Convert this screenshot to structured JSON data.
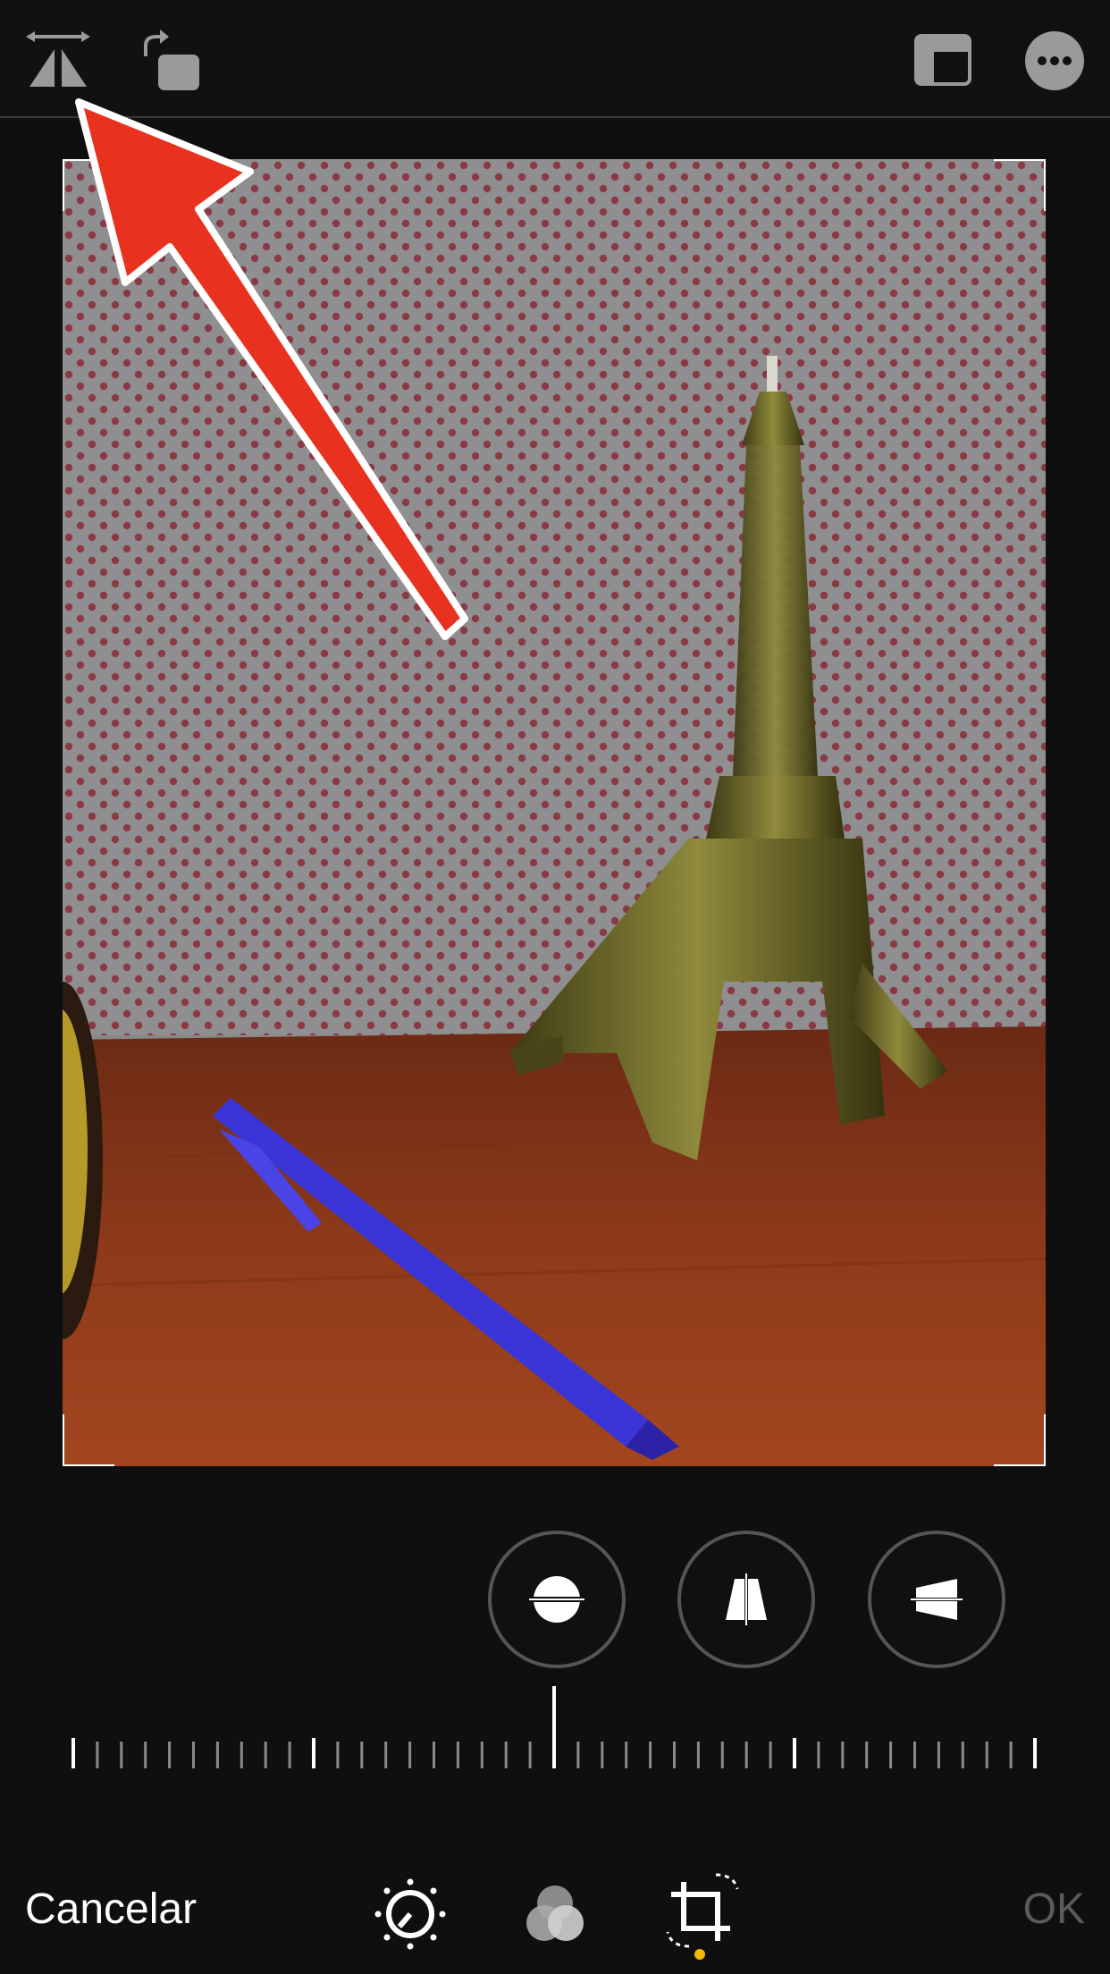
{
  "toolbar": {
    "flip_icon": "flip-horizontal-icon",
    "rotate_icon": "rotate-icon",
    "aspect_icon": "aspect-ratio-icon",
    "more_icon": "more-icon"
  },
  "adjust_tools": [
    {
      "name": "straighten",
      "icon": "straighten-icon"
    },
    {
      "name": "vertical",
      "icon": "vertical-perspective-icon"
    },
    {
      "name": "horizontal",
      "icon": "horizontal-perspective-icon"
    }
  ],
  "bottom": {
    "cancel_label": "Cancelar",
    "ok_label": "OK",
    "tabs": [
      {
        "icon": "adjust-dial-icon"
      },
      {
        "icon": "filters-icon"
      },
      {
        "icon": "crop-icon",
        "active": true
      }
    ]
  },
  "colors": {
    "background": "#0f0f0f",
    "accent_dot": "#f5b800",
    "annotation_arrow": "#e8321f",
    "ok_disabled": "#5a5a5a"
  }
}
